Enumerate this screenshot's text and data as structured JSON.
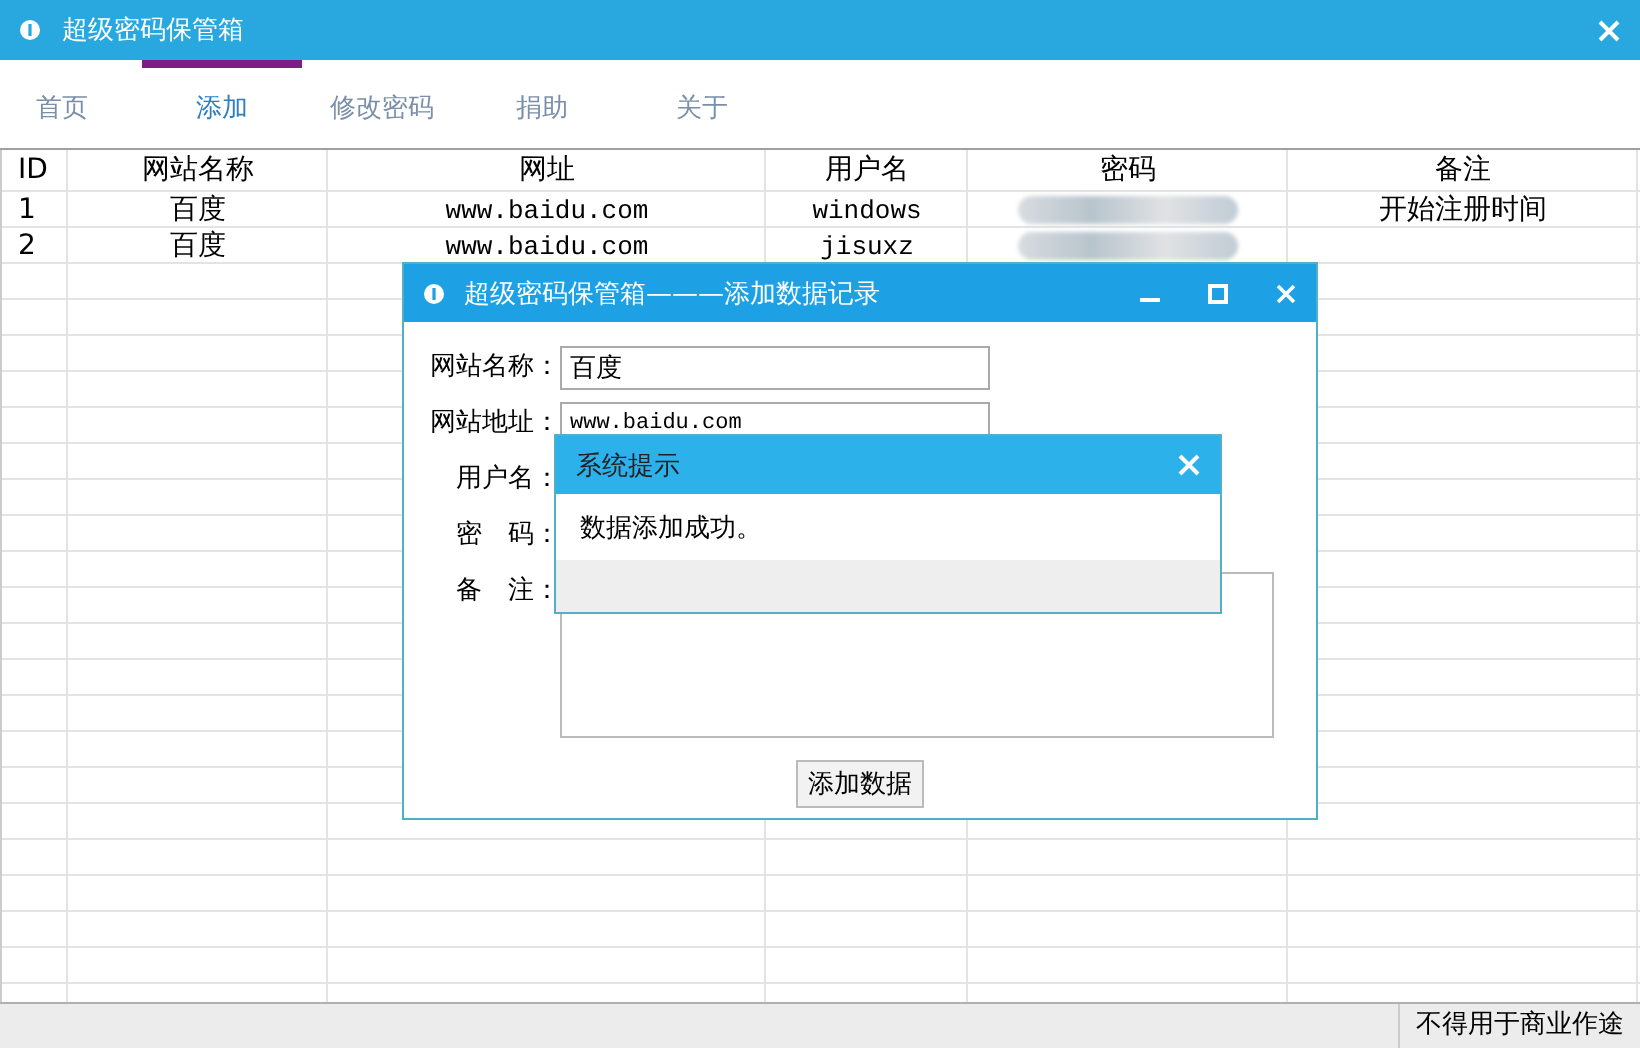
{
  "window": {
    "title": "超级密码保管箱"
  },
  "tabs": [
    {
      "label": "首页",
      "selected": false
    },
    {
      "label": "添加",
      "selected": true
    },
    {
      "label": "修改密码",
      "selected": false
    },
    {
      "label": "捐助",
      "selected": false
    },
    {
      "label": "关于",
      "selected": false
    }
  ],
  "table": {
    "columns": [
      "ID",
      "网站名称",
      "网址",
      "用户名",
      "密码",
      "备注"
    ],
    "rows": [
      {
        "id": "1",
        "site": "百度",
        "url": "www.baidu.com",
        "user": "windows",
        "password_blurred": true,
        "note": "开始注册时间"
      },
      {
        "id": "2",
        "site": "百度",
        "url": "www.baidu.com",
        "user": "jisuxz",
        "password_blurred": true
      }
    ]
  },
  "dialog": {
    "title": "超级密码保管箱———添加数据记录",
    "fields": [
      {
        "kind": "text",
        "label": "网站名称：",
        "value": "百度"
      },
      {
        "kind": "url",
        "label": "网站地址：",
        "value": "www.baidu.com"
      },
      {
        "kind": "text",
        "label": "用户名："
      },
      {
        "kind": "text",
        "label": "密　码："
      },
      {
        "kind": "textarea",
        "label": "备　注："
      }
    ],
    "submit": "添加数据"
  },
  "message_box": {
    "title": "系统提示",
    "text": "数据添加成功。"
  },
  "status_bar": {
    "text": "不得用于商业作途"
  }
}
